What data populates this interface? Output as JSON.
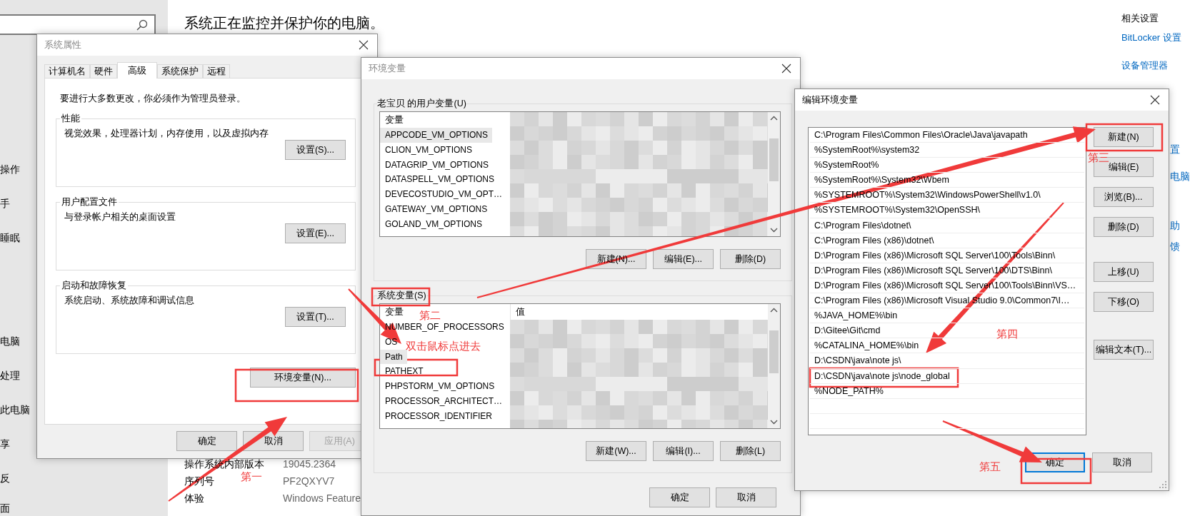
{
  "settings_page": {
    "sidebar_items": [
      "操作",
      "手",
      "睡眠",
      "电脑",
      "处理",
      "此电脑",
      "享",
      "反",
      "面"
    ],
    "heading": "系统正在监控并保护你的电脑。",
    "details": [
      {
        "label": "操作系统内部版本",
        "value": "19045.2364"
      },
      {
        "label": "序列号",
        "value": "PF2QXYV7"
      },
      {
        "label": "体验",
        "value": "Windows Feature"
      }
    ],
    "related": {
      "title": "相关设置",
      "links": [
        "BitLocker 设置",
        "设备管理器"
      ],
      "fragments": [
        "置",
        "电脑",
        "助",
        "馈"
      ]
    }
  },
  "system_properties": {
    "title": "系统属性",
    "tabs": [
      {
        "label": "计算机名",
        "selected": false
      },
      {
        "label": "硬件",
        "selected": false
      },
      {
        "label": "高级",
        "selected": true
      },
      {
        "label": "系统保护",
        "selected": false
      },
      {
        "label": "远程",
        "selected": false
      }
    ],
    "notice": "要进行大多数更改，你必须作为管理员登录。",
    "groups": [
      {
        "title": "性能",
        "description": "视觉效果，处理器计划，内存使用，以及虚拟内存",
        "button": "设置(S)..."
      },
      {
        "title": "用户配置文件",
        "description": "与登录帐户相关的桌面设置",
        "button": "设置(E)..."
      },
      {
        "title": "启动和故障恢复",
        "description": "系统启动、系统故障和调试信息",
        "button": "设置(T)..."
      }
    ],
    "env_button": "环境变量(N)...",
    "buttons": [
      {
        "label": "确定",
        "disabled": false
      },
      {
        "label": "取消",
        "disabled": false
      },
      {
        "label": "应用(A)",
        "disabled": true
      }
    ]
  },
  "environment_variables": {
    "title": "环境变量",
    "user_vars": {
      "title": "老宝贝 的用户变量(U)",
      "name_header": "变量",
      "rows": [
        {
          "name": "APPCODE_VM_OPTIONS",
          "selected": true
        },
        {
          "name": "CLION_VM_OPTIONS",
          "selected": false
        },
        {
          "name": "DATAGRIP_VM_OPTIONS",
          "selected": false
        },
        {
          "name": "DATASPELL_VM_OPTIONS",
          "selected": false
        },
        {
          "name": "DEVECOSTUDIO_VM_OPT…",
          "selected": false
        },
        {
          "name": "GATEWAY_VM_OPTIONS",
          "selected": false
        },
        {
          "name": "GOLAND_VM_OPTIONS",
          "selected": false
        }
      ],
      "buttons": [
        "新建(N)...",
        "编辑(E)...",
        "删除(D)"
      ]
    },
    "system_vars": {
      "title": "系统变量(S)",
      "name_header": "变量",
      "value_header": "值",
      "rows": [
        {
          "name": "NUMBER_OF_PROCESSORS",
          "selected": false
        },
        {
          "name": "OS",
          "selected": false
        },
        {
          "name": "Path",
          "selected": true
        },
        {
          "name": "PATHEXT",
          "selected": false
        },
        {
          "name": "PHPSTORM_VM_OPTIONS",
          "selected": false
        },
        {
          "name": "PROCESSOR_ARCHITECT…",
          "selected": false
        },
        {
          "name": "PROCESSOR_IDENTIFIER",
          "selected": false
        }
      ],
      "buttons": [
        "新建(W)...",
        "编辑(I)...",
        "删除(L)"
      ]
    },
    "buttons": [
      "确定",
      "取消"
    ]
  },
  "edit_dialog": {
    "title": "编辑环境变量",
    "entries": [
      {
        "text": "C:\\Program Files\\Common Files\\Oracle\\Java\\javapath",
        "selected": false
      },
      {
        "text": "%SystemRoot%\\system32",
        "selected": false
      },
      {
        "text": "%SystemRoot%",
        "selected": false
      },
      {
        "text": "%SystemRoot%\\System32\\Wbem",
        "selected": false
      },
      {
        "text": "%SYSTEMROOT%\\System32\\WindowsPowerShell\\v1.0\\",
        "selected": false
      },
      {
        "text": "%SYSTEMROOT%\\System32\\OpenSSH\\",
        "selected": false
      },
      {
        "text": "C:\\Program Files\\dotnet\\",
        "selected": false
      },
      {
        "text": "C:\\Program Files (x86)\\dotnet\\",
        "selected": false
      },
      {
        "text": "D:\\Program Files (x86)\\Microsoft SQL Server\\100\\Tools\\Binn\\",
        "selected": false
      },
      {
        "text": "D:\\Program Files (x86)\\Microsoft SQL Server\\100\\DTS\\Binn\\",
        "selected": false
      },
      {
        "text": "D:\\Program Files (x86)\\Microsoft SQL Server\\100\\Tools\\Binn\\VS…",
        "selected": false
      },
      {
        "text": "C:\\Program Files (x86)\\Microsoft Visual Studio 9.0\\Common7\\I…",
        "selected": false
      },
      {
        "text": "%JAVA_HOME%\\bin",
        "selected": false
      },
      {
        "text": "D:\\Gitee\\Git\\cmd",
        "selected": false
      },
      {
        "text": "%CATALINA_HOME%\\bin",
        "selected": false
      },
      {
        "text": "D:\\CSDN\\java\\note js\\",
        "selected": false
      },
      {
        "text": "D:\\CSDN\\java\\note js\\node_global",
        "selected": false
      },
      {
        "text": "%NODE_PATH%",
        "selected": false
      }
    ],
    "side_buttons": [
      "新建(N)",
      "编辑(E)",
      "浏览(B)...",
      "删除(D)",
      "上移(U)",
      "下移(O)",
      "编辑文本(T)..."
    ],
    "buttons": [
      {
        "label": "确定",
        "focused": true
      },
      {
        "label": "取消",
        "focused": false
      }
    ]
  },
  "annotations": [
    "第一",
    "第二",
    "双击鼠标点进去",
    "第三",
    "第四",
    "第五"
  ]
}
